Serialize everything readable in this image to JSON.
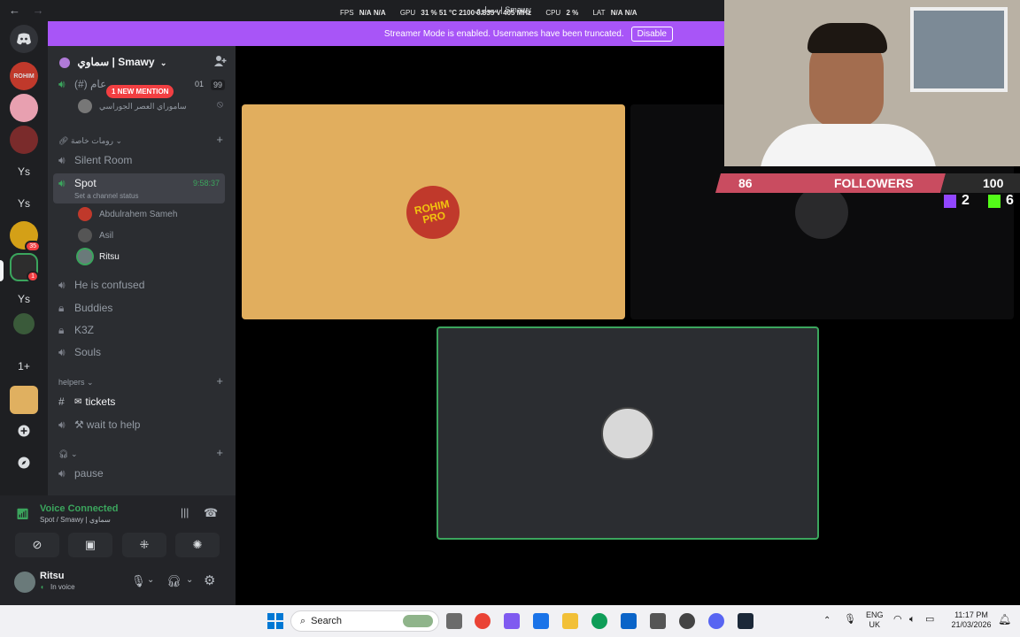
{
  "window": {
    "back_glyph": "←",
    "forward_glyph": "→",
    "title": "سماوي | Smawy",
    "perf": {
      "fps_label": "FPS",
      "fps_value": "N/A",
      "fps_value2": "N/A",
      "gpu_label": "GPU",
      "gpu_value": "31 %",
      "gpu_temp": "51 °C",
      "gpu_clock": "2100",
      "gpu_extra": "0.835 V",
      "gpu_mem": "405 MHz",
      "cpu_label": "CPU",
      "cpu_value": "2 %",
      "lat_label": "LAT",
      "lat_value": "N/A",
      "lat_value2": "N/A"
    }
  },
  "streamer_bar": {
    "message": "Streamer Mode is enabled. Usernames have been truncated.",
    "button": "Disable"
  },
  "rail": {
    "items": [
      {
        "label": "",
        "icon": "discord-home-icon",
        "color": "#5865f2"
      },
      {
        "label": "",
        "icon": "server-rohim-icon",
        "color": "#c0392b"
      },
      {
        "label": "",
        "icon": "server-pink-icon",
        "color": "#e8a0b0"
      },
      {
        "label": "",
        "icon": "server-avatar-icon",
        "color": "#7a2b2b"
      },
      {
        "label": "Ys",
        "icon": "",
        "color": "#313338"
      },
      {
        "label": "Ys",
        "icon": "",
        "color": "#313338"
      },
      {
        "label": "",
        "icon": "server-anime-icon",
        "color": "#d4a017",
        "badge": "35"
      },
      {
        "label": "",
        "icon": "server-current-icon",
        "color": "#2d2d2d",
        "badge": "1"
      },
      {
        "label": "Ys",
        "icon": "",
        "color": "#313338"
      },
      {
        "label": "",
        "icon": "server-leaf-icon",
        "color": "#3a5a3a"
      },
      {
        "label": "1+",
        "icon": "",
        "color": "#313338"
      },
      {
        "label": "",
        "icon": "server-food-icon",
        "color": "#e0b060"
      },
      {
        "label": "+",
        "icon": "add-server-icon",
        "color": "#313338"
      },
      {
        "label": "",
        "icon": "discover-icon",
        "color": "#313338"
      }
    ]
  },
  "server": {
    "name": "سماوي | Smawy",
    "mention_badge": "1 NEW MENTION",
    "top_channel": "(#) عام",
    "top_channel_count_a": "01",
    "top_channel_count_b": "99",
    "top_subtitle": "ساموراي العصر الجوراسي",
    "category_private": "رومات خاصة",
    "channels": [
      {
        "name": "Silent Room",
        "icon": "speaker-icon"
      },
      {
        "name": "Spot",
        "icon": "speaker-icon",
        "status": "Set a channel status",
        "timer": "9:58:37"
      },
      {
        "name": "He is confused",
        "icon": "speaker-icon"
      },
      {
        "name": "Buddies",
        "icon": "lock-icon"
      },
      {
        "name": "K3Z",
        "icon": "lock-icon"
      },
      {
        "name": "Souls",
        "icon": "speaker-icon"
      }
    ],
    "voice_users": [
      {
        "name": "Abdulrahem Sameh",
        "color": "#c0392b"
      },
      {
        "name": "Asil",
        "color": "#555"
      },
      {
        "name": "Ritsu",
        "color": "#6a7a7a"
      }
    ],
    "category_helpers": "helpers",
    "helpers_channels": [
      {
        "name": "tickets",
        "icon": "hash-icon"
      },
      {
        "name": "wait to help",
        "icon": "speaker-icon",
        "prefix": "⚒"
      }
    ],
    "category_unnamed": "",
    "pause_channel": "pause"
  },
  "voice_panel": {
    "status": "Voice Connected",
    "location": "Spot / Smawy | سماوي"
  },
  "user_panel": {
    "name": "Ritsu",
    "status": "In voice"
  },
  "overlay": {
    "left_count": "86",
    "title": "FOLLOWERS",
    "right_count": "100",
    "twitch_count": "2",
    "kick_count": "6"
  },
  "taskbar": {
    "search": "Search",
    "lang_top": "ENG",
    "lang_bottom": "UK",
    "time": "11:17 PM",
    "date": "21/03/2026"
  }
}
